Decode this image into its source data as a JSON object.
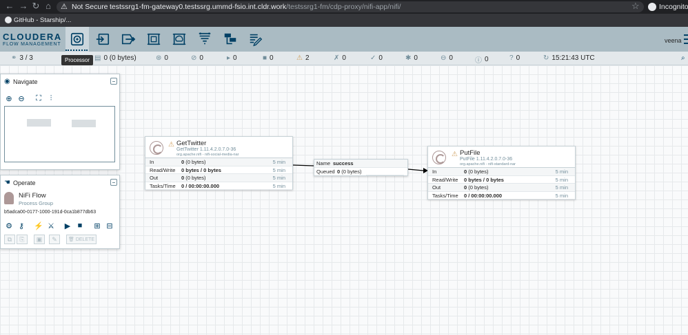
{
  "browser": {
    "security_label": "Not Secure",
    "url_host": "testssrg1-fm-gateway0.testssrg.ummd-fsio.int.cldr.work",
    "url_path": "/testssrg1-fm/cdp-proxy/nifi-app/nifi/",
    "profile_label": "Incognito",
    "bookmark": "GitHub - Starship/..."
  },
  "header": {
    "logo_name": "CLOUDERA",
    "logo_sub": "FLOW MANAGEMENT",
    "user": "veena",
    "tooltip": "Processor",
    "toolbar": [
      "processor-icon",
      "input-port-icon",
      "output-port-icon",
      "process-group-icon",
      "remote-process-group-icon",
      "funnel-icon",
      "template-icon",
      "label-icon"
    ]
  },
  "status": {
    "clustered": "3 / 3",
    "queued": "0 (0 bytes)",
    "transmitting": "0",
    "not_transmitting": "0",
    "running": "0",
    "stopped": "0",
    "invalid": "2",
    "disabled": "0",
    "up_to_date": "0",
    "locally_modified": "0",
    "stale": "0",
    "locally_modified_stale": "0",
    "sync_failure": "0",
    "last_refreshed": "15:21:43 UTC"
  },
  "navigate": {
    "title": "Navigate"
  },
  "operate": {
    "title": "Operate",
    "group_name": "NiFi Flow",
    "group_type": "Process Group",
    "group_id": "b5adca00-0177-1000-191d-0ca1b877db63",
    "delete_label": "DELETE"
  },
  "processors": [
    {
      "name": "GetTwitter",
      "type": "GetTwitter 1.11.4.2.0.7.0-36",
      "bundle": "org.apache.nifi - nifi-social-media-nar",
      "rows": [
        {
          "key": "In",
          "value": "0",
          "extra": "(0 bytes)",
          "time": "5 min"
        },
        {
          "key": "Read/Write",
          "value": "0 bytes / 0 bytes",
          "extra": "",
          "time": "5 min"
        },
        {
          "key": "Out",
          "value": "0",
          "extra": "(0 bytes)",
          "time": "5 min"
        },
        {
          "key": "Tasks/Time",
          "value": "0 / 00:00:00.000",
          "extra": "",
          "time": "5 min"
        }
      ]
    },
    {
      "name": "PutFile",
      "type": "PutFile 1.11.4.2.0.7.0-36",
      "bundle": "org.apache.nifi - nifi-standard-nar",
      "rows": [
        {
          "key": "In",
          "value": "0",
          "extra": "(0 bytes)",
          "time": "5 min"
        },
        {
          "key": "Read/Write",
          "value": "0 bytes / 0 bytes",
          "extra": "",
          "time": "5 min"
        },
        {
          "key": "Out",
          "value": "0",
          "extra": "(0 bytes)",
          "time": "5 min"
        },
        {
          "key": "Tasks/Time",
          "value": "0 / 00:00:00.000",
          "extra": "",
          "time": "5 min"
        }
      ]
    }
  ],
  "connection": {
    "name_label": "Name",
    "name_value": "success",
    "queued_label": "Queued",
    "queued_value": "0",
    "queued_extra": "(0 bytes)"
  }
}
